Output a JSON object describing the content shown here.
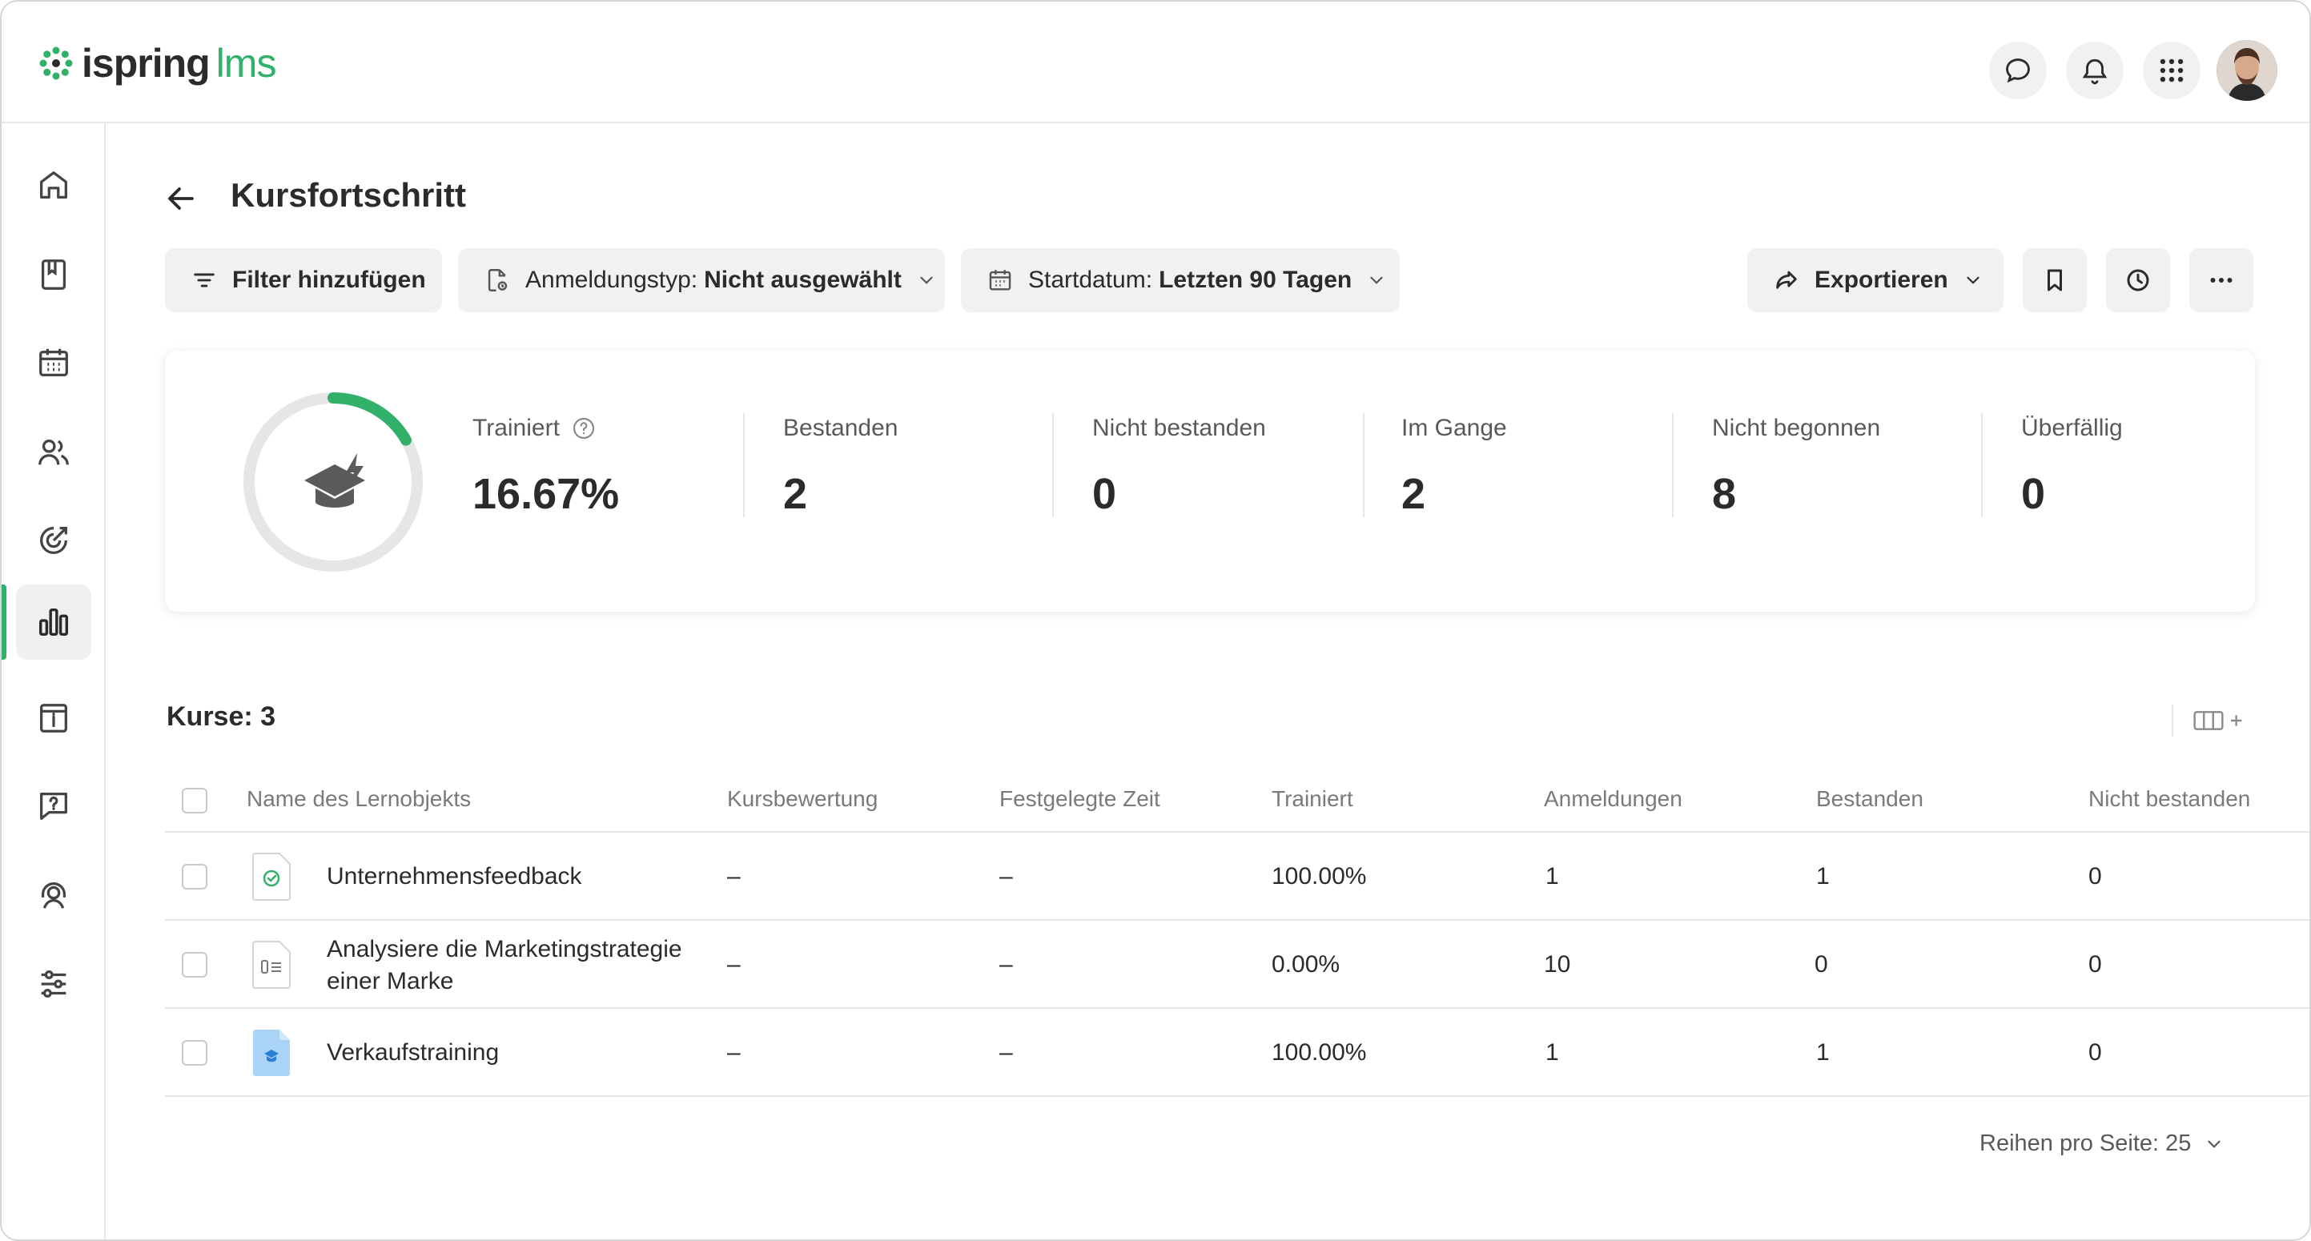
{
  "brand": {
    "name": "ispring",
    "product": "lms",
    "accent_color": "#31b06a"
  },
  "header": {
    "icons": [
      "chat-icon",
      "bell-icon",
      "apps-grid-icon"
    ],
    "avatar": "user-avatar"
  },
  "sidebar": {
    "items": [
      {
        "icon": "home-icon",
        "active": false
      },
      {
        "icon": "book-icon",
        "active": false
      },
      {
        "icon": "calendar-icon",
        "active": false
      },
      {
        "icon": "users-icon",
        "active": false
      },
      {
        "icon": "target-icon",
        "active": false
      },
      {
        "icon": "bar-chart-icon",
        "active": true
      },
      {
        "icon": "info-board-icon",
        "active": false
      },
      {
        "icon": "question-chat-icon",
        "active": false
      },
      {
        "icon": "support-agent-icon",
        "active": false
      },
      {
        "icon": "sliders-icon",
        "active": false
      }
    ]
  },
  "page": {
    "title": "Kursfortschritt"
  },
  "toolbar": {
    "add_filter": "Filter hinzufügen",
    "registration_type_label": "Anmeldungstyp:",
    "registration_type_value": "Nicht ausgewählt",
    "start_date_label": "Startdatum:",
    "start_date_value": "Letzten 90 Tagen",
    "export": "Exportieren"
  },
  "stats": {
    "trained_percent": 16.67,
    "items": [
      {
        "label": "Trainiert",
        "value": "16.67%"
      },
      {
        "label": "Bestanden",
        "value": "2"
      },
      {
        "label": "Nicht bestanden",
        "value": "0"
      },
      {
        "label": "Im Gange",
        "value": "2"
      },
      {
        "label": "Nicht begonnen",
        "value": "8"
      },
      {
        "label": "Überfällig",
        "value": "0"
      }
    ]
  },
  "table": {
    "count_label": "Kurse: 3",
    "columns": [
      "Name des Lernobjekts",
      "Kursbewertung",
      "Festgelegte Zeit",
      "Trainiert",
      "Anmeldungen",
      "Bestanden",
      "Nicht bestanden"
    ],
    "rows": [
      {
        "icon": "feedback-doc-icon",
        "name": "Unternehmensfeedback",
        "rating": "–",
        "time": "–",
        "trained": "100.00%",
        "enrollments": "1",
        "passed": "1",
        "failed": "0"
      },
      {
        "icon": "assignment-doc-icon",
        "name": "Analysiere die Marketingstrategie einer Marke",
        "rating": "–",
        "time": "–",
        "trained": "0.00%",
        "enrollments": "10",
        "passed": "0",
        "failed": "0"
      },
      {
        "icon": "course-doc-icon",
        "name": "Verkaufstraining",
        "rating": "–",
        "time": "–",
        "trained": "100.00%",
        "enrollments": "1",
        "passed": "1",
        "failed": "0"
      }
    ]
  },
  "pagination": {
    "rows_per_page": "Reihen pro Seite: 25"
  }
}
